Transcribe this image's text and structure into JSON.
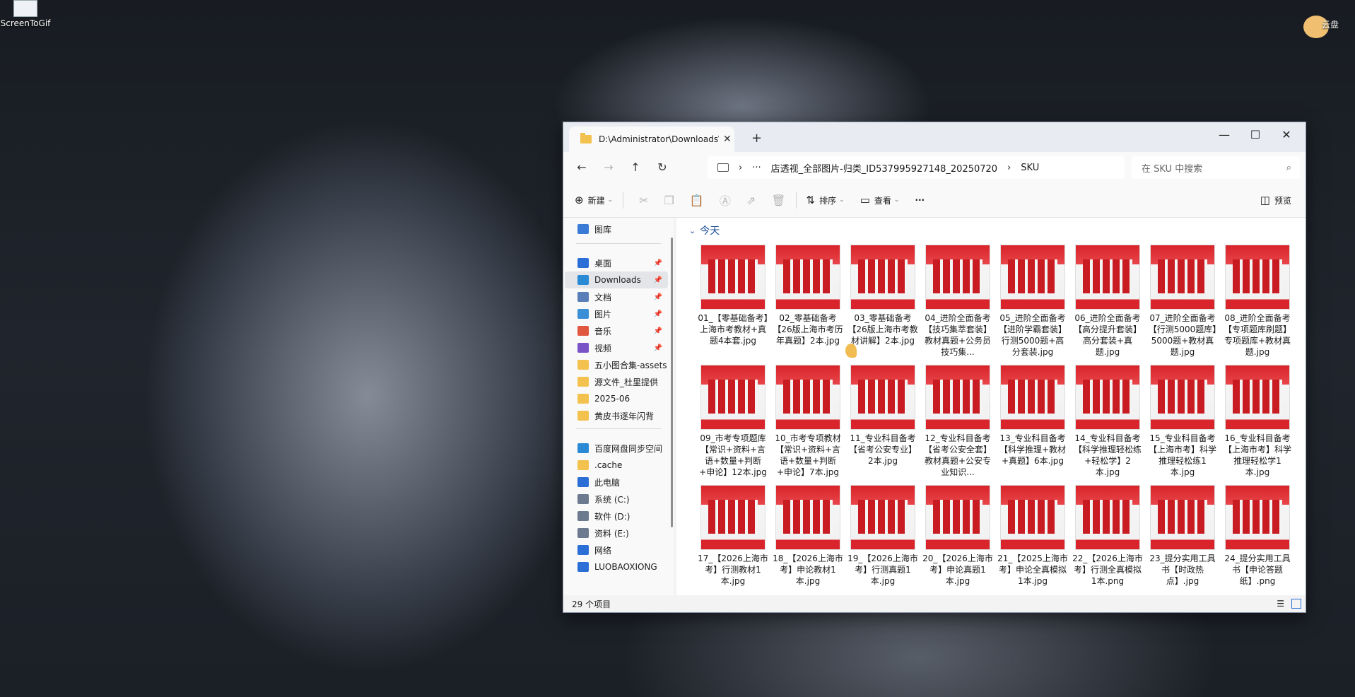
{
  "desktop": {
    "icons": [
      {
        "label": "ScreenToGif"
      },
      {
        "label": "云盘"
      }
    ]
  },
  "window": {
    "tab_title": "D:\\Administrator\\Downloads\\",
    "tab_close": "✕",
    "new_tab": "+",
    "minimize": "—",
    "maximize": "☐",
    "close": "✕"
  },
  "nav": {
    "back": "←",
    "forward": "→",
    "up": "↑",
    "refresh": "↻",
    "more": "···",
    "breadcrumb": [
      "店透视_全部图片-归类_ID537995927148_20250720",
      "SKU"
    ],
    "search_placeholder": "在 SKU 中搜索"
  },
  "toolbar": {
    "new_label": "新建",
    "sort_label": "排序",
    "view_label": "查看",
    "more": "···",
    "preview_label": "预览"
  },
  "sidebar": {
    "items": [
      {
        "label": "图库",
        "color": "#3a7bd5",
        "pinned": false
      },
      {
        "label": "桌面",
        "color": "#2b6fd6",
        "pinned": true
      },
      {
        "label": "Downloads",
        "color": "#2b8ad6",
        "pinned": true,
        "selected": true
      },
      {
        "label": "文档",
        "color": "#5a7fb8",
        "pinned": true
      },
      {
        "label": "图片",
        "color": "#3a8fd6",
        "pinned": true
      },
      {
        "label": "音乐",
        "color": "#e0583f",
        "pinned": true
      },
      {
        "label": "视频",
        "color": "#7a54c7",
        "pinned": true
      },
      {
        "label": "五小图合集-assets",
        "color": "#f3c24e",
        "pinned": false
      },
      {
        "label": "源文件_杜里提供",
        "color": "#f3c24e",
        "pinned": false
      },
      {
        "label": "2025-06",
        "color": "#f3c24e",
        "pinned": false
      },
      {
        "label": "黄皮书逐年闪背",
        "color": "#f3c24e",
        "pinned": false
      },
      {
        "label": "百度网盘同步空间",
        "color": "#2b8ad6",
        "pinned": false
      },
      {
        "label": ".cache",
        "color": "#f3c24e",
        "pinned": false
      },
      {
        "label": "此电脑",
        "color": "#2b6fd6",
        "pinned": false
      },
      {
        "label": "系统 (C:)",
        "color": "#6b7a8f",
        "pinned": false
      },
      {
        "label": "软件 (D:)",
        "color": "#6b7a8f",
        "pinned": false
      },
      {
        "label": "资料 (E:)",
        "color": "#6b7a8f",
        "pinned": false
      },
      {
        "label": "网络",
        "color": "#2b6fd6",
        "pinned": false
      },
      {
        "label": "LUOBAOXIONG",
        "color": "#2b6fd6",
        "pinned": false
      }
    ]
  },
  "content": {
    "group_label": "今天",
    "files": [
      "01_【零基础备考】上海市考教材+真题4本套.jpg",
      "02_零基础备考【26版上海市考历年真题】2本.jpg",
      "03_零基础备考【26版上海市考教材讲解】2本.jpg",
      "04_进阶全面备考【技巧集萃套装】教材真题+公务员技巧集...",
      "05_进阶全面备考【进阶学霸套装】行测5000题+高分套装.jpg",
      "06_进阶全面备考【高分提升套装】高分套装+真题.jpg",
      "07_进阶全面备考【行测5000题库】5000题+教材真题.jpg",
      "08_进阶全面备考【专项题库刷题】专项题库+教材真题.jpg",
      "09_市考专项题库【常识+资料+言语+数量+判断+申论】12本.jpg",
      "10_市考专项教材【常识+资料+言语+数量+判断+申论】7本.jpg",
      "11_专业科目备考【省考公安专业】2本.jpg",
      "12_专业科目备考【省考公安全套】教材真题+公安专业知识...",
      "13_专业科目备考【科学推理+教材+真题】6本.jpg",
      "14_专业科目备考【科学推理轻松练+轻松学】2本.jpg",
      "15_专业科目备考【上海市考】科学推理轻松练1本.jpg",
      "16_专业科目备考【上海市考】科学推理轻松学1本.jpg",
      "17_【2026上海市考】行测教材1本.jpg",
      "18_【2026上海市考】申论教材1本.jpg",
      "19_【2026上海市考】行测真题1本.jpg",
      "20_【2026上海市考】申论真题1本.jpg",
      "21_【2025上海市考】申论全真模拟1本.jpg",
      "22_【2026上海市考】行测全真模拟1本.png",
      "23_提分实用工具书【时政热点】.jpg",
      "24_提分实用工具书【申论答题纸】.png"
    ]
  },
  "status": {
    "item_count": "29 个项目"
  }
}
